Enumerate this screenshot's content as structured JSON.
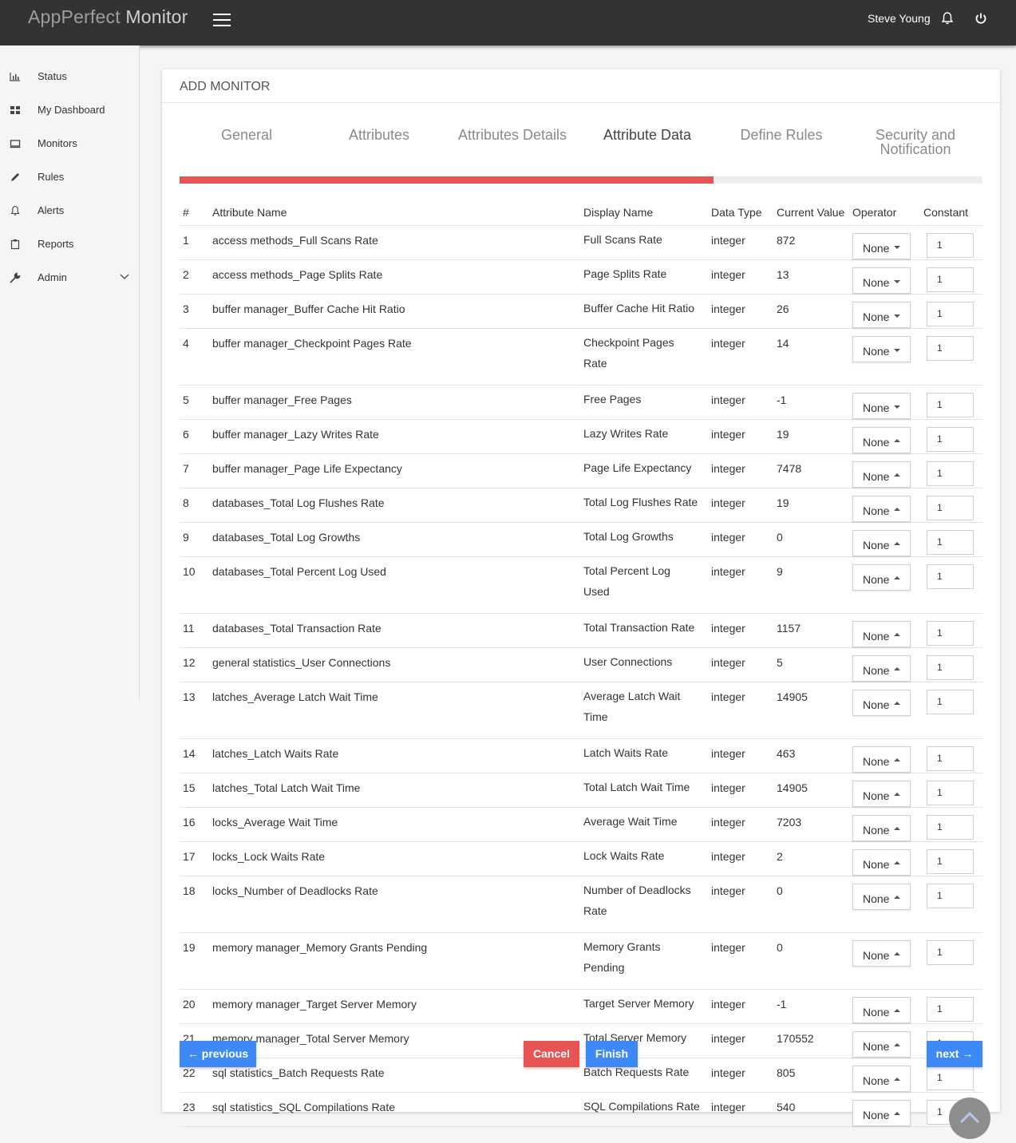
{
  "header": {
    "brand_part1": "AppPerfect",
    "brand_part2": "Monitor",
    "user_name": "Steve Young",
    "menu_icon": "hamburger-icon",
    "notification_icon": "bell-icon",
    "logout_icon": "power-icon"
  },
  "sidebar": {
    "items": [
      {
        "label": "Status",
        "icon": "bar-chart-icon"
      },
      {
        "label": "My Dashboard",
        "icon": "dashboard-icon"
      },
      {
        "label": "Monitors",
        "icon": "monitor-icon"
      },
      {
        "label": "Rules",
        "icon": "pencil-icon"
      },
      {
        "label": "Alerts",
        "icon": "bell-icon"
      },
      {
        "label": "Reports",
        "icon": "clipboard-icon"
      },
      {
        "label": "Admin",
        "icon": "wrench-icon"
      }
    ]
  },
  "card": {
    "title": "ADD MONITOR",
    "steps": [
      "General",
      "Attributes",
      "Attributes Details",
      "Attribute Data",
      "Define Rules",
      "Security and Notification"
    ],
    "active_step": "Attribute Data",
    "progress_fraction": 0.665
  },
  "table": {
    "headers": [
      "#",
      "Attribute Name",
      "Display Name",
      "Data Type",
      "Current Value",
      "Operator",
      "Constant"
    ],
    "rows": [
      {
        "num": "1",
        "name": "access methods_Full Scans Rate",
        "display": [
          "Full Scans Rate"
        ],
        "type": "integer",
        "value": "872",
        "operator": "None",
        "caret": "down",
        "constant": "1"
      },
      {
        "num": "2",
        "name": "access methods_Page Splits Rate",
        "display": [
          "Page Splits Rate"
        ],
        "type": "integer",
        "value": "13",
        "operator": "None",
        "caret": "down",
        "constant": "1"
      },
      {
        "num": "3",
        "name": "buffer manager_Buffer Cache Hit Ratio",
        "display": [
          "Buffer Cache Hit Ratio"
        ],
        "type": "integer",
        "value": "26",
        "operator": "None",
        "caret": "down",
        "constant": "1"
      },
      {
        "num": "4",
        "name": "buffer manager_Checkpoint Pages Rate",
        "display": [
          "Checkpoint Pages",
          "Rate"
        ],
        "type": "integer",
        "value": "14",
        "operator": "None",
        "caret": "down",
        "constant": "1"
      },
      {
        "num": "5",
        "name": "buffer manager_Free Pages",
        "display": [
          "Free Pages"
        ],
        "type": "integer",
        "value": "-1",
        "operator": "None",
        "caret": "down",
        "constant": "1"
      },
      {
        "num": "6",
        "name": "buffer manager_Lazy Writes Rate",
        "display": [
          "Lazy Writes Rate"
        ],
        "type": "integer",
        "value": "19",
        "operator": "None",
        "caret": "up",
        "constant": "1"
      },
      {
        "num": "7",
        "name": "buffer manager_Page Life Expectancy",
        "display": [
          "Page Life Expectancy"
        ],
        "type": "integer",
        "value": "7478",
        "operator": "None",
        "caret": "up",
        "constant": "1"
      },
      {
        "num": "8",
        "name": "databases_Total Log Flushes Rate",
        "display": [
          "Total Log Flushes Rate"
        ],
        "type": "integer",
        "value": "19",
        "operator": "None",
        "caret": "up",
        "constant": "1"
      },
      {
        "num": "9",
        "name": "databases_Total Log Growths",
        "display": [
          "Total Log Growths"
        ],
        "type": "integer",
        "value": "0",
        "operator": "None",
        "caret": "up",
        "constant": "1"
      },
      {
        "num": "10",
        "name": "databases_Total Percent Log Used",
        "display": [
          "Total Percent Log",
          "Used"
        ],
        "type": "integer",
        "value": "9",
        "operator": "None",
        "caret": "up",
        "constant": "1"
      },
      {
        "num": "11",
        "name": "databases_Total Transaction Rate",
        "display": [
          "Total Transaction Rate"
        ],
        "type": "integer",
        "value": "1157",
        "operator": "None",
        "caret": "up",
        "constant": "1"
      },
      {
        "num": "12",
        "name": "general statistics_User Connections",
        "display": [
          "User Connections"
        ],
        "type": "integer",
        "value": "5",
        "operator": "None",
        "caret": "up",
        "constant": "1"
      },
      {
        "num": "13",
        "name": "latches_Average Latch Wait Time",
        "display": [
          "Average Latch Wait",
          "Time"
        ],
        "type": "integer",
        "value": "14905",
        "operator": "None",
        "caret": "up",
        "constant": "1"
      },
      {
        "num": "14",
        "name": "latches_Latch Waits Rate",
        "display": [
          "Latch Waits Rate"
        ],
        "type": "integer",
        "value": "463",
        "operator": "None",
        "caret": "up",
        "constant": "1"
      },
      {
        "num": "15",
        "name": "latches_Total Latch Wait Time",
        "display": [
          "Total Latch Wait Time"
        ],
        "type": "integer",
        "value": "14905",
        "operator": "None",
        "caret": "up",
        "constant": "1"
      },
      {
        "num": "16",
        "name": "locks_Average Wait Time",
        "display": [
          "Average Wait Time"
        ],
        "type": "integer",
        "value": "7203",
        "operator": "None",
        "caret": "up",
        "constant": "1"
      },
      {
        "num": "17",
        "name": "locks_Lock Waits Rate",
        "display": [
          "Lock Waits Rate"
        ],
        "type": "integer",
        "value": "2",
        "operator": "None",
        "caret": "up",
        "constant": "1"
      },
      {
        "num": "18",
        "name": "locks_Number of Deadlocks Rate",
        "display": [
          "Number of Deadlocks",
          "Rate"
        ],
        "type": "integer",
        "value": "0",
        "operator": "None",
        "caret": "up",
        "constant": "1"
      },
      {
        "num": "19",
        "name": "memory manager_Memory Grants Pending",
        "display": [
          "Memory Grants",
          "Pending"
        ],
        "type": "integer",
        "value": "0",
        "operator": "None",
        "caret": "up",
        "constant": "1"
      },
      {
        "num": "20",
        "name": "memory manager_Target Server Memory",
        "display": [
          "Target Server Memory"
        ],
        "type": "integer",
        "value": "-1",
        "operator": "None",
        "caret": "up",
        "constant": "1"
      },
      {
        "num": "21",
        "name": "memory manager_Total Server Memory",
        "display": [
          "Total Server Memory"
        ],
        "type": "integer",
        "value": "170552",
        "operator": "None",
        "caret": "up",
        "constant": "1"
      },
      {
        "num": "22",
        "name": "sql statistics_Batch Requests Rate",
        "display": [
          "Batch Requests Rate"
        ],
        "type": "integer",
        "value": "805",
        "operator": "None",
        "caret": "up",
        "constant": "1"
      },
      {
        "num": "23",
        "name": "sql statistics_SQL Compilations Rate",
        "display": [
          "SQL Compilations Rate"
        ],
        "type": "integer",
        "value": "540",
        "operator": "None",
        "caret": "up",
        "constant": "1"
      }
    ]
  },
  "buttons": {
    "previous": "← previous",
    "cancel": "Cancel",
    "finish": "Finish",
    "next": "next →"
  },
  "scroll_top_icon": "chevron-up-icon",
  "colors": {
    "topbar": "#333333",
    "accent_blue": "#3d8af7",
    "danger_red": "#e85454",
    "progress_track": "#eeeeee"
  }
}
